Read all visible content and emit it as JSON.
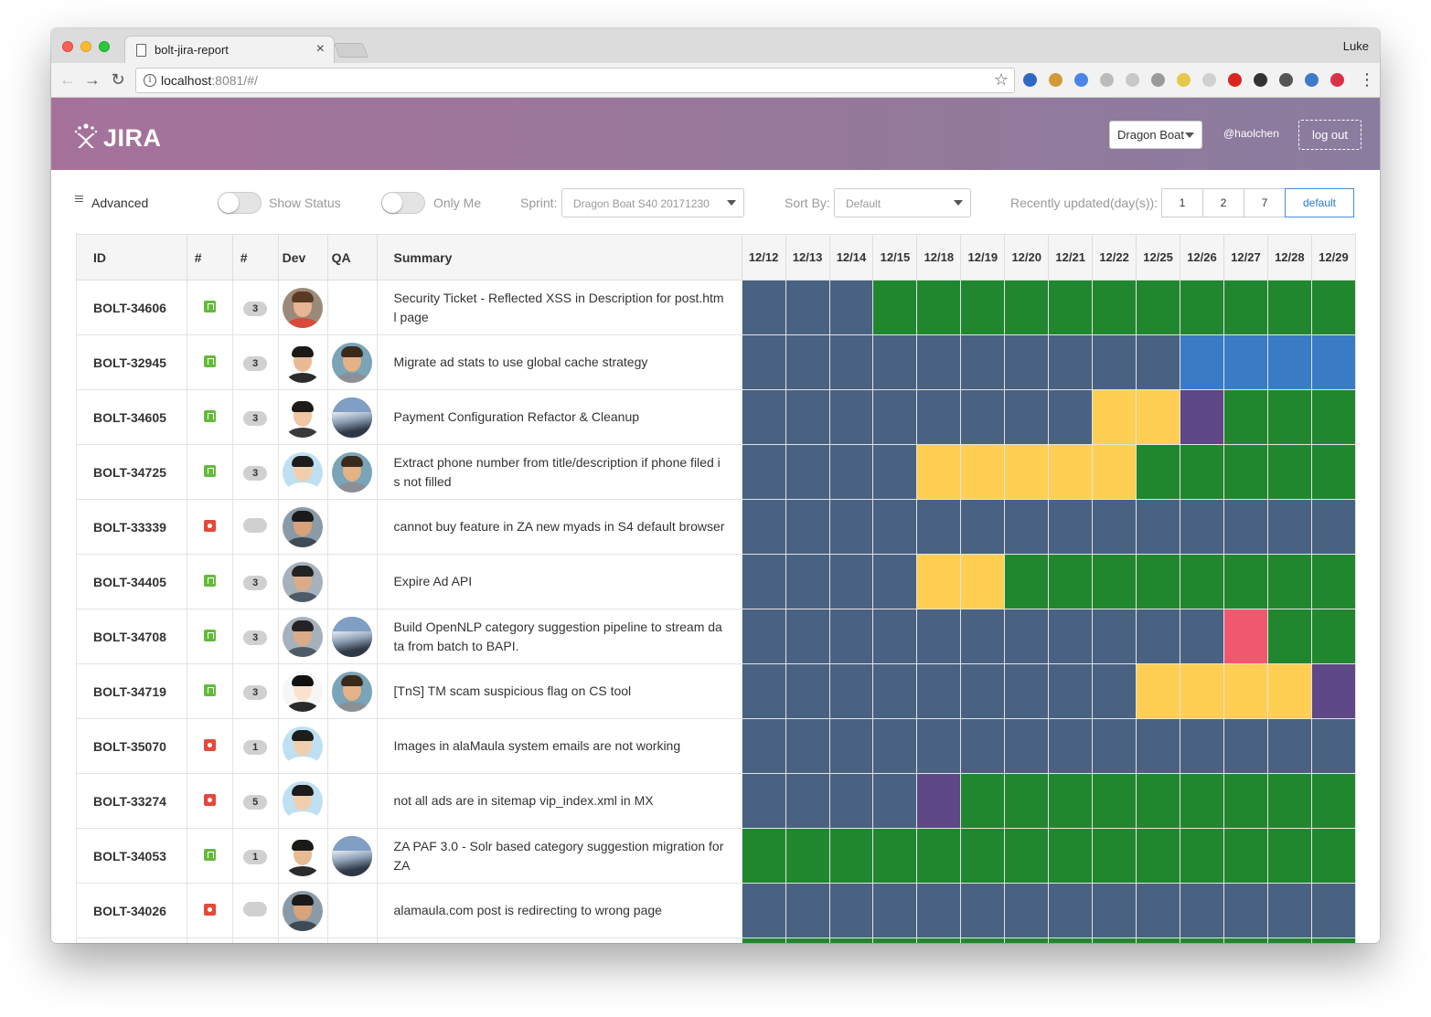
{
  "browser": {
    "tab_title": "bolt-jira-report",
    "tab_close": "×",
    "profile": "Luke",
    "url_host": "localhost",
    "url_rest": ":8081/#/",
    "nav_back": "←",
    "nav_forward": "→",
    "nav_reload": "↻",
    "info_glyph": "i",
    "star_glyph": "☆",
    "menu_glyph": "⋮",
    "extensions": [
      {
        "name": "globe-extension-icon",
        "color": "#2d68c4"
      },
      {
        "name": "cookie-extension-icon",
        "color": "#d39a3a"
      },
      {
        "name": "translate-extension-icon",
        "color": "#4a86e8"
      },
      {
        "name": "circle-extension-icon",
        "color": "#bbbbbb"
      },
      {
        "name": "moon-extension-icon",
        "color": "#c8c8c8"
      },
      {
        "name": "pin-extension-icon",
        "color": "#9a9a9a"
      },
      {
        "name": "star-extension-icon",
        "color": "#e6c84b"
      },
      {
        "name": "face-extension-icon",
        "color": "#d0d0d0"
      },
      {
        "name": "opera-extension-icon",
        "color": "#d9261c"
      },
      {
        "name": "glasses-extension-icon",
        "color": "#333333"
      },
      {
        "name": "screenshot-extension-icon",
        "color": "#555555"
      },
      {
        "name": "earth-extension-icon",
        "color": "#3f79c9"
      },
      {
        "name": "shield-extension-icon",
        "color": "#d8324b"
      }
    ]
  },
  "header": {
    "logo_text": "JIRA",
    "project": "Dragon Boat",
    "user": "@haolchen",
    "logout": "log out"
  },
  "controls": {
    "advanced": "Advanced",
    "show_status": "Show Status",
    "only_me": "Only Me",
    "sprint_label": "Sprint:",
    "sprint_value": "Dragon Boat S40 20171230",
    "sort_label": "Sort By:",
    "sort_value": "Default",
    "recent_label": "Recently updated(day(s)):",
    "recent_options": [
      "1",
      "2",
      "7",
      "default"
    ],
    "recent_selected": "default"
  },
  "status_colors": {
    "N": "#4a6282",
    "G": "#21872f",
    "B": "#3a7bc6",
    "Y": "#fecf53",
    "P": "#5e4886",
    "R": "#f0586f"
  },
  "table": {
    "headers": {
      "id": "ID",
      "type": "#",
      "points": "#",
      "dev": "Dev",
      "qa": "QA",
      "summary": "Summary"
    },
    "dates": [
      "12/12",
      "12/13",
      "12/14",
      "12/15",
      "12/18",
      "12/19",
      "12/20",
      "12/21",
      "12/22",
      "12/25",
      "12/26",
      "12/27",
      "12/28",
      "12/29"
    ],
    "rows": [
      {
        "id": "BOLT-34606",
        "type": "story",
        "points": "3",
        "dev": "dev-colorful",
        "qa": "",
        "summary": "Security Ticket - Reflected XSS in Description for post.htm l page",
        "status": "NNNGGGGGGGGGGG"
      },
      {
        "id": "BOLT-32945",
        "type": "story",
        "points": "3",
        "dev": "dev-man1",
        "qa": "qa-cartoon",
        "summary": "Migrate ad stats to use global cache strategy",
        "status": "NNNNNNNNNNBBBB"
      },
      {
        "id": "BOLT-34605",
        "type": "story",
        "points": "3",
        "dev": "dev-woman1",
        "qa": "qa-mountain",
        "summary": "Payment Configuration Refactor & Cleanup",
        "status": "NNNNNNNNYYPGGG"
      },
      {
        "id": "BOLT-34725",
        "type": "story",
        "points": "3",
        "dev": "dev-glasses",
        "qa": "qa-cartoon",
        "summary": "Extract phone number from title/description if phone filed i s not filled",
        "status": "NNNNYYYYYGGGGG"
      },
      {
        "id": "BOLT-33339",
        "type": "bug",
        "points": "",
        "dev": "dev-man2",
        "qa": "",
        "summary": "cannot buy feature in ZA new myads in S4 default browser",
        "status": "NNNNNNNNNNNNNN"
      },
      {
        "id": "BOLT-34405",
        "type": "story",
        "points": "3",
        "dev": "dev-man3",
        "qa": "",
        "summary": "Expire Ad API",
        "status": "NNNNYYGGGGGGGG"
      },
      {
        "id": "BOLT-34708",
        "type": "story",
        "points": "3",
        "dev": "dev-man3",
        "qa": "qa-mountain",
        "summary": "Build OpenNLP category suggestion pipeline to stream da ta from batch to BAPI.",
        "status": "NNNNNNNNNNNRGG"
      },
      {
        "id": "BOLT-34719",
        "type": "story",
        "points": "3",
        "dev": "dev-anime",
        "qa": "qa-cartoon",
        "summary": "[TnS] TM scam suspicious flag on CS tool",
        "status": "NNNNNNNNNYYYYP"
      },
      {
        "id": "BOLT-35070",
        "type": "bug",
        "points": "1",
        "dev": "dev-glasses",
        "qa": "",
        "summary": "Images in alaMaula system emails are not working",
        "status": "NNNNNNNNNNNNNN"
      },
      {
        "id": "BOLT-33274",
        "type": "bug",
        "points": "5",
        "dev": "dev-glasses",
        "qa": "",
        "summary": "not all ads are in sitemap vip_index.xml in MX",
        "status": "NNNNPGGGGGGGGG"
      },
      {
        "id": "BOLT-34053",
        "type": "story",
        "points": "1",
        "dev": "dev-man1",
        "qa": "qa-mountain",
        "summary": "ZA PAF 3.0 - Solr based category suggestion migration for ZA",
        "status": "GGGGGGGGGGGGGG"
      },
      {
        "id": "BOLT-34026",
        "type": "bug",
        "points": "",
        "dev": "dev-man2",
        "qa": "",
        "summary": "alamaula.com post is redirecting to wrong page",
        "status": "NNNNNNNNNNNNNN"
      },
      {
        "id": "",
        "type": "none",
        "points": "",
        "dev": "",
        "qa": "",
        "summary": "",
        "status": "GGGGGGGGGGGGGG"
      }
    ]
  }
}
